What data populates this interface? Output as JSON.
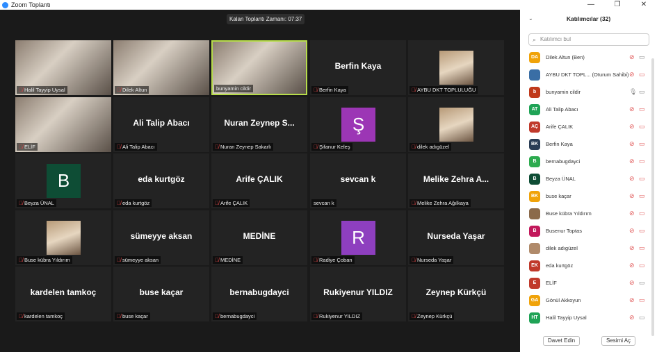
{
  "window": {
    "title": "Zoom Toplantı",
    "controls": [
      "—",
      "❐",
      "✕"
    ]
  },
  "timer": "Kalan Toplantı Zamanı: 07:37",
  "tiles": [
    {
      "type": "video",
      "label": "Halil Tayyip Uysal",
      "muted": true
    },
    {
      "type": "video",
      "label": "Dilek Altun",
      "muted": true
    },
    {
      "type": "video",
      "label": "bunyamin cildir",
      "muted": false,
      "active": true
    },
    {
      "type": "name",
      "big": "Berfin Kaya",
      "label": "Berfin Kaya",
      "muted": true
    },
    {
      "type": "photo",
      "label": "AYBU DKT TOPLULUĞU",
      "muted": true
    },
    {
      "type": "video",
      "label": "ELİF",
      "muted": true
    },
    {
      "type": "name",
      "big": "Ali Talip Abacı",
      "label": "Ali Talip Abacı",
      "muted": true
    },
    {
      "type": "name",
      "big": "Nuran Zeynep S...",
      "label": "Nuran Zeynep Sakarlı",
      "muted": true
    },
    {
      "type": "avatar",
      "letter": "Ş",
      "color": "#9c36b5",
      "label": "Şifanur Keleş",
      "muted": true
    },
    {
      "type": "photo",
      "label": "dilek adıgüzel",
      "muted": true
    },
    {
      "type": "avatar",
      "letter": "B",
      "color": "#0e4d35",
      "label": "Beyza ÜNAL",
      "muted": true
    },
    {
      "type": "name",
      "big": "eda kurtgöz",
      "label": "eda kurtgöz",
      "muted": true
    },
    {
      "type": "name",
      "big": "Arife ÇALIK",
      "label": "Arife ÇALIK",
      "muted": true
    },
    {
      "type": "name",
      "big": "sevcan k",
      "label": "sevcan k",
      "muted": false
    },
    {
      "type": "name",
      "big": "Melike Zehra A...",
      "label": "Melike Zehra Ağılkaya",
      "muted": true
    },
    {
      "type": "photo",
      "label": "Buse kübra Yıldırım",
      "muted": true
    },
    {
      "type": "name",
      "big": "sümeyye aksan",
      "label": "sümeyye aksan",
      "muted": true
    },
    {
      "type": "name",
      "big": "MEDİNE",
      "label": "MEDİNE",
      "muted": true
    },
    {
      "type": "avatar",
      "letter": "R",
      "color": "#8e3fbf",
      "label": "Radiye Çoban",
      "muted": true
    },
    {
      "type": "name",
      "big": "Nurseda Yaşar",
      "label": "Nurseda Yaşar",
      "muted": true
    },
    {
      "type": "name",
      "big": "kardelen tamkoç",
      "label": "kardelen tamkoç",
      "muted": true
    },
    {
      "type": "name",
      "big": "buse kaçar",
      "label": "buse kaçar",
      "muted": true
    },
    {
      "type": "name",
      "big": "bernabugdayci",
      "label": "bernabugdayci",
      "muted": true
    },
    {
      "type": "name",
      "big": "Rukiyenur YILDIZ",
      "label": "Rukiyenur YILDIZ",
      "muted": true
    },
    {
      "type": "name",
      "big": "Zeynep Kürkçü",
      "label": "Zeynep Kürkçü",
      "muted": true
    }
  ],
  "panel": {
    "title": "Katılımcılar (32)",
    "search_placeholder": "Katılımcı bul",
    "participants": [
      {
        "initials": "DA",
        "color": "#f0a30a",
        "name": "Dilek Altun (Ben)",
        "mic": "muted",
        "video": "on"
      },
      {
        "initials": "",
        "color": "#3a6ea5",
        "name": "AYBU DKT TOPL... (Oturum Sahibi)",
        "mic": "muted",
        "video": "off"
      },
      {
        "initials": "b",
        "color": "#c0391b",
        "name": "bunyamin cildir",
        "mic": "on",
        "video": "on"
      },
      {
        "initials": "AT",
        "color": "#1fa356",
        "name": "Ali Talip Abacı",
        "mic": "muted",
        "video": "off"
      },
      {
        "initials": "AÇ",
        "color": "#c0392b",
        "name": "Arife ÇALIK",
        "mic": "muted",
        "video": "off"
      },
      {
        "initials": "BK",
        "color": "#2a3d55",
        "name": "Berfin Kaya",
        "mic": "muted",
        "video": "off"
      },
      {
        "initials": "B",
        "color": "#2dab4f",
        "name": "bernabugdayci",
        "mic": "muted",
        "video": "off"
      },
      {
        "initials": "B",
        "color": "#0e4d35",
        "name": "Beyza ÜNAL",
        "mic": "muted",
        "video": "off"
      },
      {
        "initials": "BK",
        "color": "#f0a30a",
        "name": "buse kaçar",
        "mic": "muted",
        "video": "off"
      },
      {
        "initials": "",
        "color": "#8b6a4a",
        "name": "Buse kübra Yıldırım",
        "mic": "muted",
        "video": "off"
      },
      {
        "initials": "B",
        "color": "#c2185b",
        "name": "Busenur Toptas",
        "mic": "muted",
        "video": "off"
      },
      {
        "initials": "",
        "color": "#b08a6a",
        "name": "dilek adıgüzel",
        "mic": "muted",
        "video": "off"
      },
      {
        "initials": "EK",
        "color": "#c0392b",
        "name": "eda kurtgöz",
        "mic": "muted",
        "video": "off"
      },
      {
        "initials": "E",
        "color": "#c0392b",
        "name": "ELİF",
        "mic": "muted",
        "video": "on"
      },
      {
        "initials": "GA",
        "color": "#f0a30a",
        "name": "Gönül Akkoyun",
        "mic": "muted",
        "video": "off"
      },
      {
        "initials": "HT",
        "color": "#1fa356",
        "name": "Halil Tayyip Uysal",
        "mic": "muted",
        "video": "on"
      }
    ],
    "invite_label": "Davet Edin",
    "unmute_label": "Sesimi Aç"
  }
}
